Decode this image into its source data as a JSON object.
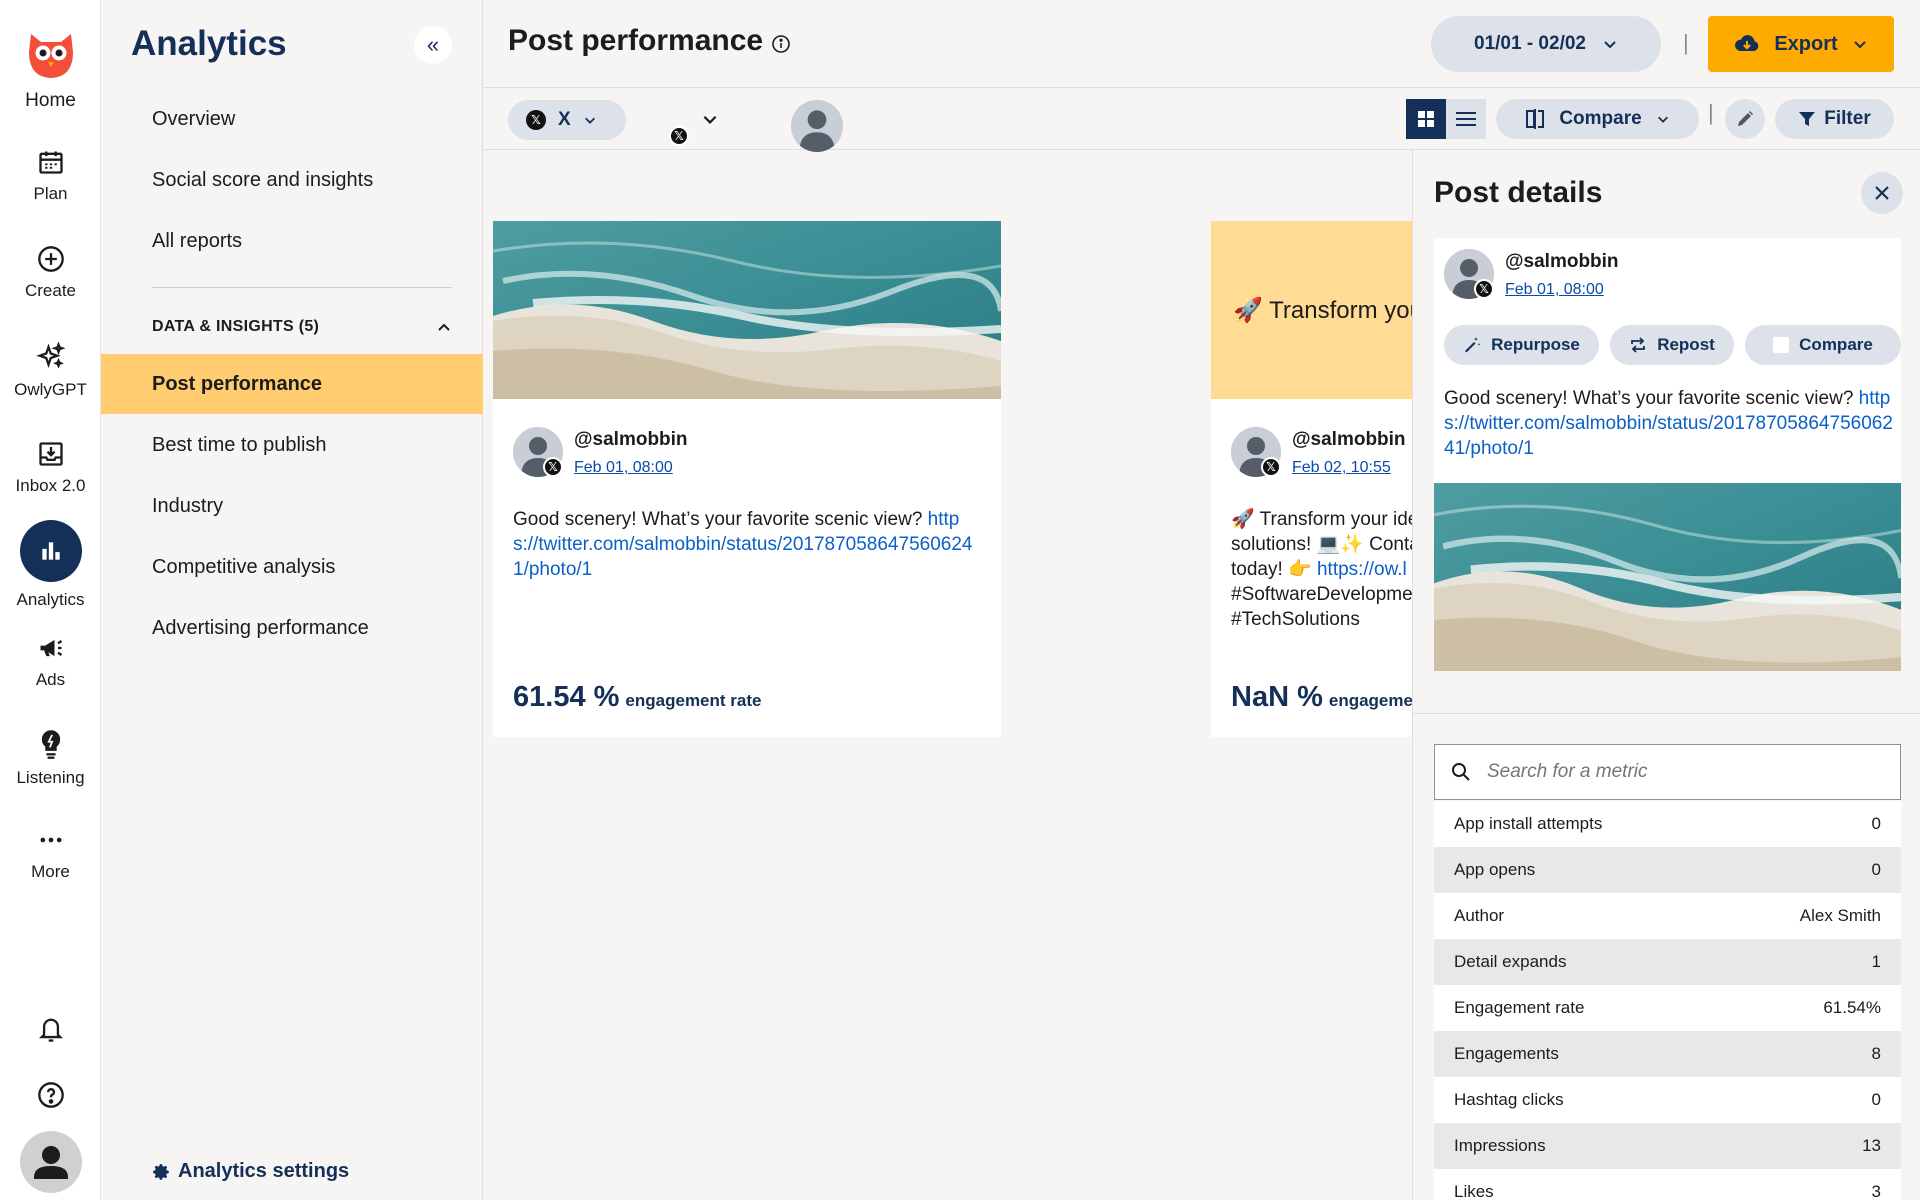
{
  "rail": {
    "items": [
      {
        "label": "Home",
        "icon": "owl-logo-icon"
      },
      {
        "label": "Plan",
        "icon": "calendar-icon"
      },
      {
        "label": "Create",
        "icon": "plus-circle-icon"
      },
      {
        "label": "OwlyGPT",
        "icon": "sparkles-icon"
      },
      {
        "label": "Inbox 2.0",
        "icon": "inbox-icon"
      },
      {
        "label": "Analytics",
        "icon": "bar-chart-icon"
      },
      {
        "label": "Ads",
        "icon": "megaphone-icon"
      },
      {
        "label": "Listening",
        "icon": "lightbulb-icon"
      },
      {
        "label": "More",
        "icon": "more-dots-icon"
      }
    ],
    "accent": "#143059"
  },
  "sidebar": {
    "title": "Analytics",
    "items": [
      "Overview",
      "Social score and insights",
      "All reports"
    ],
    "section_label": "DATA & INSIGHTS (5)",
    "section_items": [
      "Post performance",
      "Best time to publish",
      "Industry",
      "Competitive analysis",
      "Advertising performance"
    ],
    "active": "Post performance",
    "settings_label": "Analytics settings"
  },
  "header": {
    "title": "Post performance",
    "date_range": "01/01 - 02/02",
    "sep": "|",
    "export_label": "Export"
  },
  "toolbar": {
    "network_label": "X",
    "compare_label": "Compare",
    "filter_label": "Filter"
  },
  "cards": [
    {
      "handle": "@salmobbin",
      "date": "Feb 01, 08:00",
      "text": "Good scenery! What’s your favorite scenic view? ",
      "link": "https://twitter.com/salmobbin/status/2017870586475606241/photo/1",
      "metric_value": "61.54 %",
      "metric_label": "engagement rate"
    },
    {
      "promo_text": "🚀 Transform you",
      "handle": "@salmobbin",
      "date": "Feb 02, 10:55",
      "line1": "🚀 Transform your ide",
      "line2": "solutions! 💻✨ Conta",
      "line3_text": "today! 👉 ",
      "line3_link": "https://ow.l",
      "line4": "#SoftwareDevelopme",
      "line5": "#TechSolutions",
      "metric_value": "NaN %",
      "metric_label": "engagemer"
    }
  ],
  "details": {
    "title": "Post details",
    "handle": "@salmobbin",
    "date": "Feb 01, 08:00",
    "actions": {
      "repurpose": "Repurpose",
      "repost": "Repost",
      "compare": "Compare"
    },
    "text": "Good scenery! What’s your favorite scenic view? ",
    "link": "https://twitter.com/salmobbin/status/2017870586475606241/photo/1",
    "search_placeholder": "Search for a metric",
    "metrics": [
      {
        "label": "App install attempts",
        "value": "0"
      },
      {
        "label": "App opens",
        "value": "0"
      },
      {
        "label": "Author",
        "value": "Alex Smith"
      },
      {
        "label": "Detail expands",
        "value": "1"
      },
      {
        "label": "Engagement rate",
        "value": "61.54%"
      },
      {
        "label": "Engagements",
        "value": "8"
      },
      {
        "label": "Hashtag clicks",
        "value": "0"
      },
      {
        "label": "Impressions",
        "value": "13"
      },
      {
        "label": "Likes",
        "value": "3"
      }
    ]
  },
  "colors": {
    "highlight": "#ffcc70",
    "export": "#ffaa00",
    "navy": "#143059",
    "link": "#0b60c8"
  }
}
